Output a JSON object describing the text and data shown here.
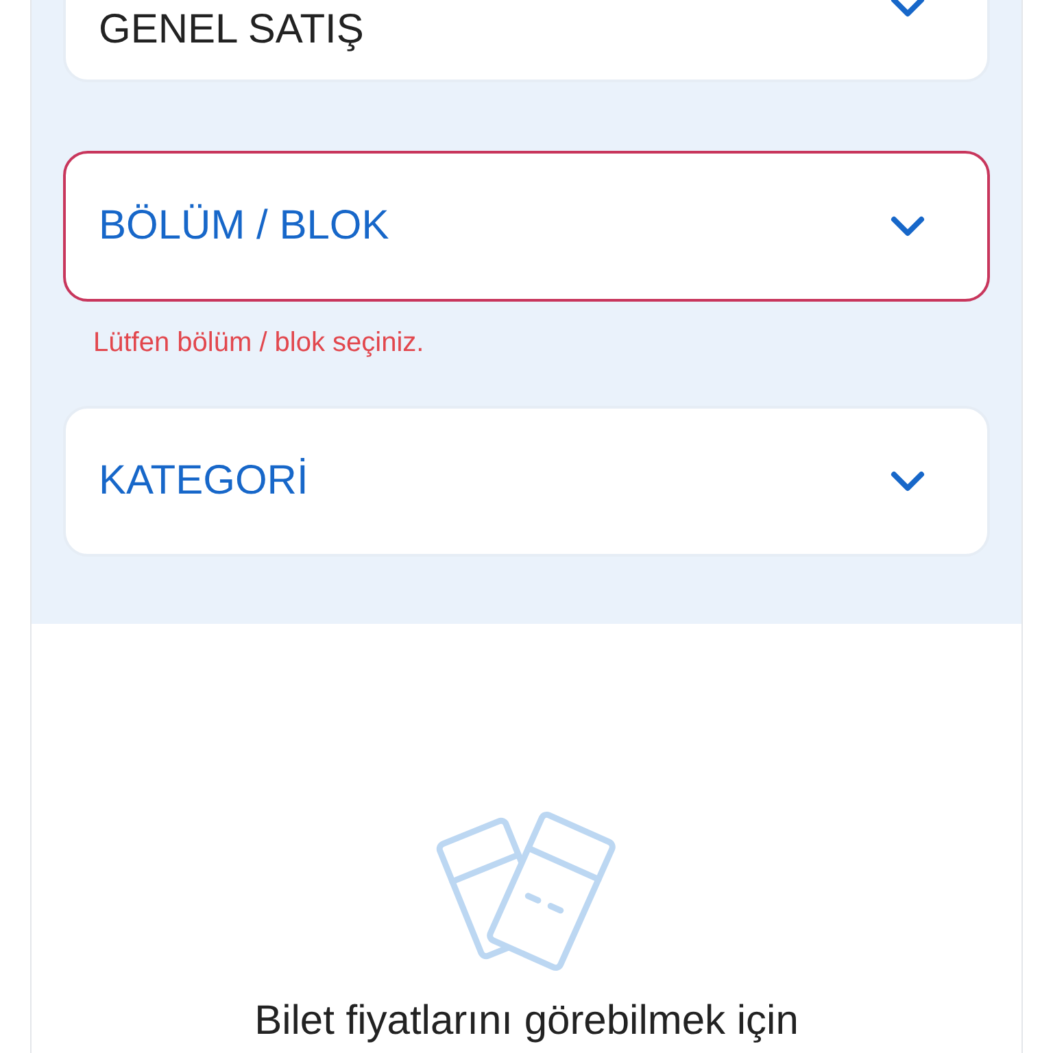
{
  "dropdowns": [
    {
      "value": "GENEL SATIŞ",
      "error": false
    },
    {
      "placeholder": "BÖLÜM / BLOK",
      "error": true,
      "error_message": "Lütfen bölüm / blok seçiniz."
    },
    {
      "placeholder": "KATEGORİ",
      "error": false
    }
  ],
  "empty_state": {
    "message": "Bilet fiyatlarını görebilmek için"
  }
}
